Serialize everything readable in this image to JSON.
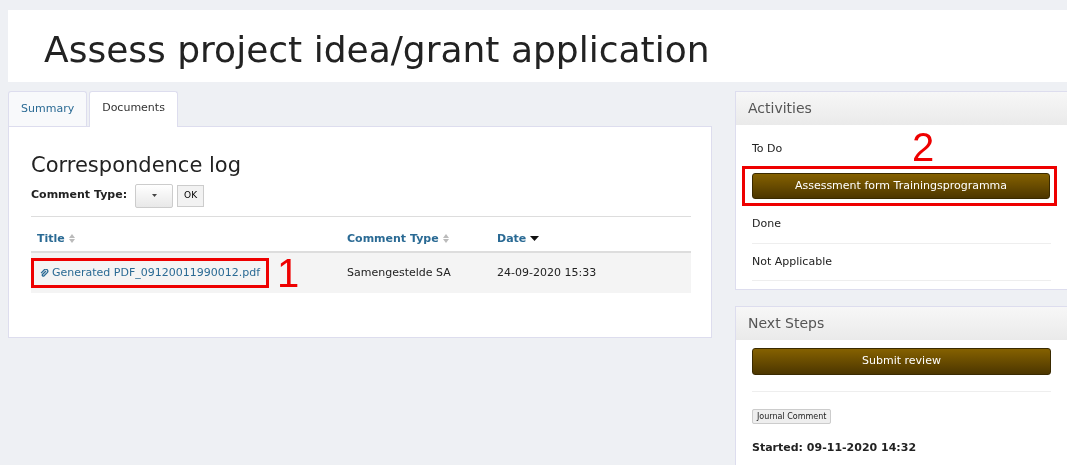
{
  "page": {
    "title": "Assess project idea/grant application"
  },
  "tabs": [
    {
      "label": "Summary",
      "selected": false
    },
    {
      "label": "Documents",
      "selected": true
    }
  ],
  "correspondence_log": {
    "heading": "Correspondence log",
    "filter_label": "Comment Type:",
    "ok_button": "OK",
    "columns": [
      {
        "label": "Title",
        "sorted": false
      },
      {
        "label": "Comment Type",
        "sorted": false
      },
      {
        "label": "Date",
        "sorted": true
      }
    ],
    "rows": [
      {
        "title": "Generated PDF_09120011990012.pdf",
        "comment_type": "Samengestelde SA",
        "date": "24-09-2020 15:33",
        "callout": "1"
      }
    ]
  },
  "activities": {
    "heading": "Activities",
    "to_do_label": "To Do",
    "to_do_button": "Assessment form Trainingsprogramma",
    "to_do_callout": "2",
    "done_label": "Done",
    "not_applicable_label": "Not Applicable"
  },
  "next_steps": {
    "heading": "Next Steps",
    "button": "Submit review",
    "tag": "Journal Comment",
    "started": "Started: 09-11-2020 14:32"
  }
}
